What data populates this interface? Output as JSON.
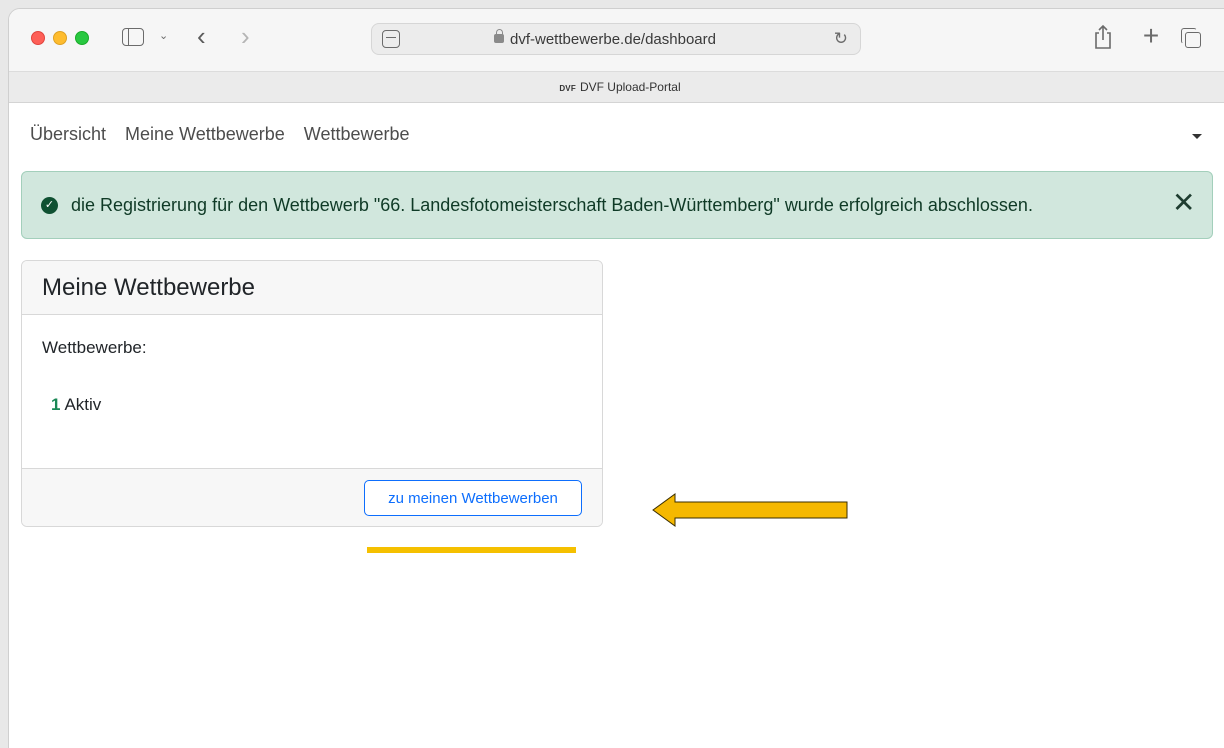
{
  "browser": {
    "url": "dvf-wettbewerbe.de/dashboard",
    "tab_favicon": "DVF",
    "tab_title": "DVF Upload-Portal"
  },
  "nav": {
    "items": [
      {
        "label": "Übersicht"
      },
      {
        "label": "Meine Wettbewerbe"
      },
      {
        "label": "Wettbewerbe"
      }
    ]
  },
  "alert": {
    "message": "die Registrierung für den Wettbewerb \"66. Landesfotomeisterschaft Baden-Württemberg\" wurde erfolgreich abschlossen.",
    "close_glyph": "✕",
    "check_glyph": "✓"
  },
  "card": {
    "title": "Meine Wettbewerbe",
    "label": "Wettbewerbe:",
    "active_count": "1",
    "active_label": "Aktiv",
    "button_label": "zu meinen Wettbewerben"
  },
  "annotation": {
    "arrow_color": "#f5b800",
    "line_color": "#f5c000"
  }
}
